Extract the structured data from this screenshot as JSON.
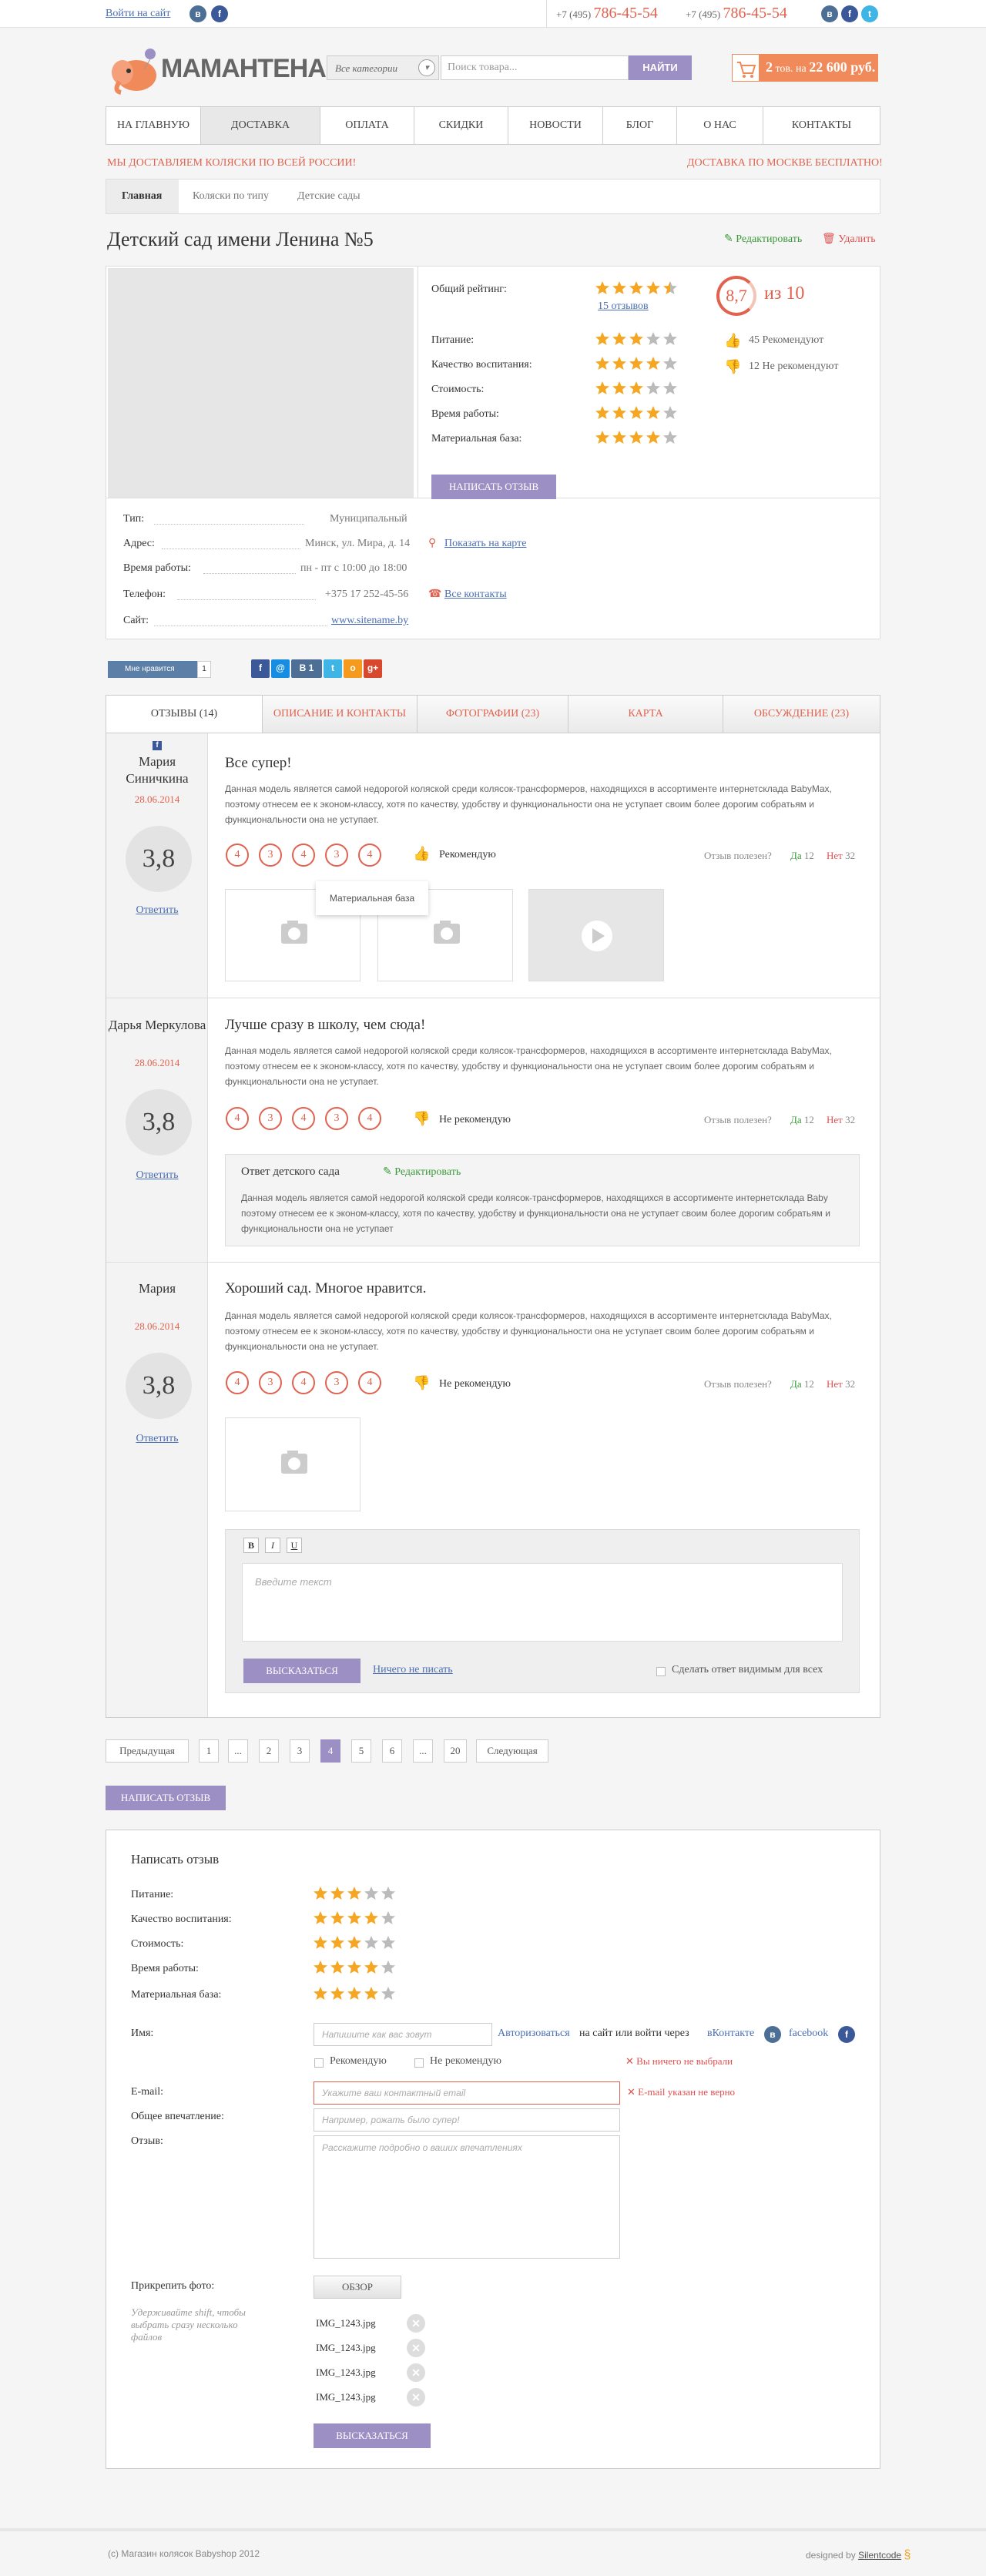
{
  "topbar": {
    "login": "Войти на сайт",
    "phone_code_1": "+7 (495)",
    "phone_num_1": "786-45-54",
    "phone_code_2": "+7 (495)",
    "phone_num_2": "786-45-54"
  },
  "header": {
    "logo": "МАМАНТЕНА",
    "category": "Все категории",
    "search_placeholder": "Поиск товара...",
    "search_button": "НАЙТИ",
    "cart_count": "2",
    "cart_mid": "тов. на",
    "cart_sum": "22 600 руб."
  },
  "nav": [
    "НА ГЛАВНУЮ",
    "ДОСТАВКА",
    "ОПЛАТА",
    "СКИДКИ",
    "НОВОСТИ",
    "БЛОГ",
    "О НАС",
    "КОНТАКТЫ"
  ],
  "promo": {
    "left": "МЫ ДОСТАВЛЯЕМ КОЛЯСКИ ПО ВСЕЙ РОССИИ!",
    "right": "ДОСТАВКА ПО МОСКВЕ БЕСПЛАТНО!"
  },
  "breadcrumb": [
    "Главная",
    "Коляски по типу",
    "Детские сады"
  ],
  "page": {
    "title": "Детский сад имени Ленина №5",
    "edit": "Редактировать",
    "delete": "Удалить"
  },
  "rating": {
    "overall_label": "Общий рейтинг:",
    "overall_stars": 4.5,
    "reviews_link": "15 отзывов",
    "score": "8,7",
    "out_of": "из 10",
    "recommend": "45 Рекомендуют",
    "not_recommend": "12 Не рекомендуют",
    "items": [
      {
        "label": "Питание:",
        "stars": 3
      },
      {
        "label": "Качество воспитания:",
        "stars": 4
      },
      {
        "label": "Стоимость:",
        "stars": 3
      },
      {
        "label": "Время работы:",
        "stars": 4
      },
      {
        "label": "Материальная база:",
        "stars": 4
      }
    ],
    "write_button": "НАПИСАТЬ ОТЗЫВ"
  },
  "info": [
    {
      "label": "Тип:",
      "value": "Муниципальный"
    },
    {
      "label": "Адрес:",
      "value": "Минск, ул. Мира, д. 14",
      "link": "Показать на карте"
    },
    {
      "label": "Время работы:",
      "value": "пн - пт с 10:00 до 18:00"
    },
    {
      "label": "Телефон:",
      "value": "+375 17 252-45-56",
      "link": "Все контакты"
    },
    {
      "label": "Сайт:",
      "value": "www.sitename.by"
    }
  ],
  "share": {
    "like_label": "Мне нравится",
    "like_count": "1",
    "vk_count": "1"
  },
  "tabs": [
    "ОТЗЫВЫ (14)",
    "ОПИСАНИЕ И КОНТАКТЫ",
    "ФОТОГРАФИИ (23)",
    "КАРТА",
    "ОБСУЖДЕНИЕ (23)"
  ],
  "reviews": [
    {
      "author": "Мария Синичкина",
      "date": "28.06.2014",
      "score": "3,8",
      "reply": "Ответить",
      "title": "Все супер!",
      "body": "Данная модель является самой недорогой коляской среди колясок-трансформеров, находящихся в ассортименте интернетсклада BabyMax, поэтому отнесем ее к эконом-классу, хотя по качеству, удобству и функциональности она не  уступает своим более дорогим собратьям и функциональности она не  уступает.",
      "marks": [
        "4",
        "3",
        "4",
        "3",
        "4"
      ],
      "verdict": "Рекомендую",
      "useful": "Отзыв полезен?",
      "yes": "Да",
      "yes_count": "12",
      "no": "Нет",
      "no_count": "32"
    },
    {
      "author": "Дарья Меркулова",
      "date": "28.06.2014",
      "score": "3,8",
      "reply": "Ответить",
      "title": "Лучше сразу в школу, чем сюда!",
      "body": "Данная модель является самой недорогой коляской среди колясок-трансформеров, находящихся в ассортименте интернетсклада BabyMax, поэтому отнесем ее к эконом-классу, хотя по качеству, удобству и функциональности она не  уступает своим более дорогим собратьям и функциональности она не  уступает.",
      "marks": [
        "4",
        "3",
        "4",
        "3",
        "4"
      ],
      "verdict": "Не рекомендую",
      "useful": "Отзыв полезен?",
      "yes": "Да",
      "yes_count": "12",
      "no": "Нет",
      "no_count": "32"
    },
    {
      "author": "Мария",
      "date": "28.06.2014",
      "score": "3,8",
      "reply": "Ответить",
      "title": "Хороший сад. Многое нравится.",
      "body": "Данная модель является самой недорогой коляской среди колясок-трансформеров, находящихся в ассортименте интернетсклада BabyMax, поэтому отнесем ее к эконом-классу, хотя по качеству, удобству и функциональности она не  уступает своим более дорогим собратьям и функциональности она не  уступает.",
      "marks": [
        "4",
        "3",
        "4",
        "3",
        "4"
      ],
      "verdict": "Не рекомендую",
      "useful": "Отзыв полезен?",
      "yes": "Да",
      "yes_count": "12",
      "no": "Нет",
      "no_count": "32"
    }
  ],
  "tooltip": "Материальная база",
  "answer": {
    "title": "Ответ детского сада",
    "edit": "Редактировать",
    "body": "Данная модель является самой недорогой коляской среди колясок-трансформеров, находящихся в ассортименте интернетсклада Baby поэтому отнесем ее к эконом-классу, хотя по качеству, удобству и функциональности она не  уступает своим более дорогим собратьям и функциональности она не  уступает"
  },
  "editor": {
    "b": "B",
    "i": "I",
    "u": "U",
    "placeholder": "Введите текст",
    "submit": "ВЫСКАЗАТЬСЯ",
    "cancel": "Ничего не писать",
    "visible_label": "Сделать ответ видимым для всех"
  },
  "pagination": {
    "prev": "Предыдущая",
    "pages": [
      "1",
      "...",
      "2",
      "3",
      "4",
      "5",
      "6",
      "...",
      "20"
    ],
    "active": "4",
    "next": "Следующая"
  },
  "write_button2": "НАПИСАТЬ ОТЗЫВ",
  "form": {
    "title": "Написать отзыв",
    "ratings": [
      {
        "label": "Питание:",
        "stars": 3
      },
      {
        "label": "Качество воспитания:",
        "stars": 4
      },
      {
        "label": "Стоимость:",
        "stars": 3
      },
      {
        "label": "Время работы:",
        "stars": 4
      },
      {
        "label": "Материальная база:",
        "stars": 4
      }
    ],
    "name_label": "Имя:",
    "name_placeholder": "Напишите как вас зовут",
    "auth_1": "Авторизоваться",
    "auth_2": "на сайт или войти через",
    "auth_vk": "вКонтакте",
    "auth_fb": "facebook",
    "rec": "Рекомендую",
    "notrec": "Не рекомендую",
    "rec_error": "Вы ничего не выбрали",
    "email_label": "E-mail:",
    "email_placeholder": "Укажите ваш контактный email",
    "email_error": "E-mail указан не верно",
    "impression_label": "Общее впечатление:",
    "impression_placeholder": "Например, рожать было супер!",
    "review_label": "Отзыв:",
    "review_placeholder": "Расскажите подробно о ваших впечатлениях",
    "photo_label": "Прикрепить фото:",
    "photo_hint": "Удерживайте shift, чтобы выбрать сразу несколько файлов",
    "browse": "ОБЗОР",
    "files": [
      "IMG_1243.jpg",
      "IMG_1243.jpg",
      "IMG_1243.jpg",
      "IMG_1243.jpg"
    ],
    "submit": "ВЫСКАЗАТЬСЯ"
  },
  "footer": {
    "copyright": "(с) Магазин колясок Babyshop 2012",
    "designed": "designed by",
    "studio": "Silentcode"
  },
  "colors": {
    "accent": "#e0624f",
    "purple": "#9b8fc3",
    "star": "#f5a623",
    "link": "#4a6fb5"
  }
}
